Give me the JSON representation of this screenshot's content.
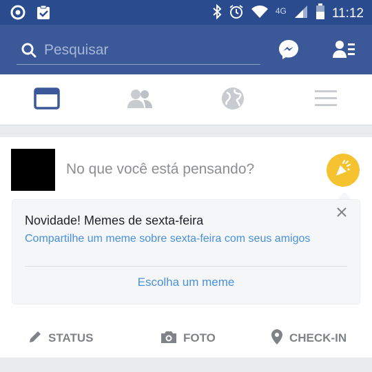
{
  "status_bar": {
    "time": "11:12",
    "network": "4G",
    "left_icons": [
      "circle-app-icon",
      "clipboard-check-icon"
    ],
    "right_icons": [
      "bluetooth-icon",
      "alarm-icon",
      "wifi-icon",
      "signal-icon",
      "battery-icon"
    ]
  },
  "header": {
    "search_placeholder": "Pesquisar",
    "icons": [
      "search-icon",
      "messenger-icon",
      "friend-requests-icon"
    ],
    "brand_color": "#3b5998"
  },
  "nav_tabs": [
    {
      "name": "news-feed",
      "icon": "news-feed-icon",
      "active": true
    },
    {
      "name": "friends",
      "icon": "friends-icon",
      "active": false
    },
    {
      "name": "notifications",
      "icon": "globe-icon",
      "active": false
    },
    {
      "name": "menu",
      "icon": "menu-icon",
      "active": false
    }
  ],
  "composer": {
    "prompt": "No que você está pensando?",
    "sticker_icon": "party-popper-icon"
  },
  "promo": {
    "title": "Novidade! Memes de sexta-feira",
    "subtitle": "Compartilhe um meme sobre sexta-feira com seus amigos",
    "link": "Escolha um meme",
    "close_icon": "close-icon"
  },
  "actions": [
    {
      "label": "STATUS",
      "icon": "pencil-icon"
    },
    {
      "label": "FOTO",
      "icon": "camera-icon"
    },
    {
      "label": "CHECK-IN",
      "icon": "location-pin-icon"
    }
  ]
}
